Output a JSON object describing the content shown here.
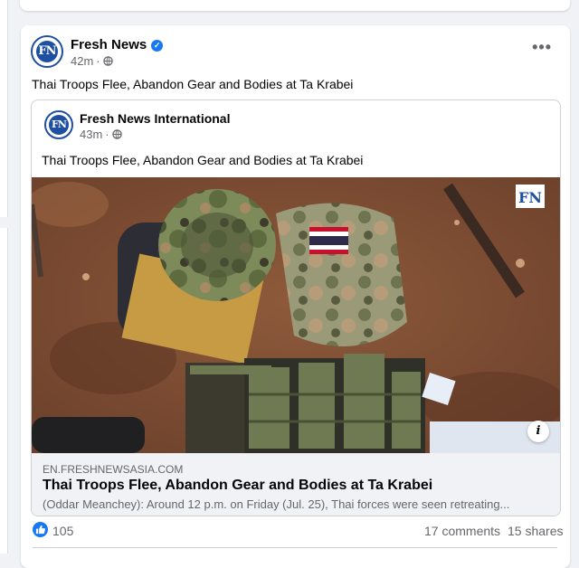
{
  "post": {
    "author": "Fresh News",
    "logo_text": "FN",
    "time": "42m",
    "verified": "✓",
    "text": "Thai Troops Flee, Abandon Gear and Bodies at Ta Krabei",
    "more": "•••"
  },
  "shared": {
    "author": "Fresh News International",
    "logo_text": "FN",
    "time": "43m",
    "text": "Thai Troops Flee, Abandon Gear and Bodies at Ta Krabei",
    "watermark": "FN",
    "info": "i",
    "link": {
      "domain": "EN.FRESHNEWSASIA.COM",
      "title": "Thai Troops Flee, Abandon Gear and Bodies at Ta Krabei",
      "description": "(Oddar Meanchey): Around 12 p.m. on Friday (Jul. 25), Thai forces were seen retreating..."
    }
  },
  "stats": {
    "likes": "105",
    "comments": "17 comments",
    "shares": "15 shares"
  },
  "colors": {
    "accent": "#1877f2",
    "brand_blue": "#1f4fa0",
    "muted": "#65676b"
  }
}
